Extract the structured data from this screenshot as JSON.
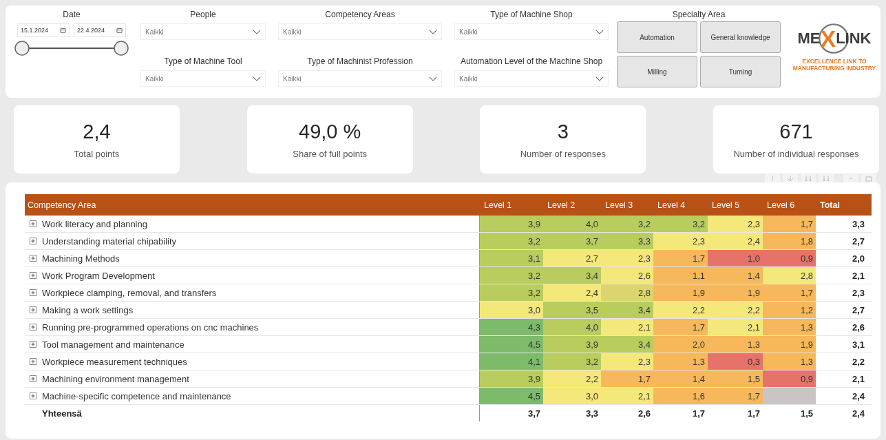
{
  "filters": {
    "date": {
      "label": "Date",
      "start": "15.1.2024",
      "end": "22.4.2024",
      "thumbs": [
        {
          "level": 0
        },
        {
          "level": 1
        }
      ]
    },
    "dropdowns": [
      {
        "label": "People",
        "value": "Kaikki"
      },
      {
        "label": "Competency Areas",
        "value": "Kaikki"
      },
      {
        "label": "Type of Machine Shop",
        "value": "Kaikki"
      },
      {
        "label": "Type of Machine Tool",
        "value": "Kaikki"
      },
      {
        "label": "Type of Machinist Profession",
        "value": "Kaikki"
      },
      {
        "label": "Automation Level of the Machine Shop",
        "value": "Kaikki"
      }
    ],
    "specialty": {
      "label": "Specialty Area",
      "buttons": [
        "Automation",
        "General knowledge",
        "Milling",
        "Turning"
      ]
    }
  },
  "logo": {
    "left": "ME",
    "mark": "X",
    "right": "LINK",
    "tagline": "EXCELLENCE LINK TO MANUFACTURING INDUSTRY"
  },
  "kpis": [
    {
      "value": "2,4",
      "label": "Total points"
    },
    {
      "value": "49,0 %",
      "label": "Share of full points"
    },
    {
      "value": "3",
      "label": "Number of responses"
    },
    {
      "value": "671",
      "label": "Number of individual responses"
    }
  ],
  "table": {
    "columns": [
      "Competency Area",
      "Level 1",
      "Level 2",
      "Level 3",
      "Level 4",
      "Level 5",
      "Level 6",
      "Total"
    ],
    "rows": [
      {
        "name": "Work literacy and planning",
        "expanded": false,
        "cells": [
          {
            "value": "3,9",
            "color": "#b9cc5e"
          },
          {
            "value": "4,0",
            "color": "#b9cc5e"
          },
          {
            "value": "3,2",
            "color": "#b9cc5e"
          },
          {
            "value": "3,2",
            "color": "#b9cc5e"
          },
          {
            "value": "2,3",
            "color": "#f5e87a"
          },
          {
            "value": "1,7",
            "color": "#f6b85a"
          }
        ],
        "total": "3,3"
      },
      {
        "name": "Understanding material chipability",
        "expanded": false,
        "cells": [
          {
            "value": "3,2",
            "color": "#b9cc5e"
          },
          {
            "value": "3,7",
            "color": "#b9cc5e"
          },
          {
            "value": "3,3",
            "color": "#b9cc5e"
          },
          {
            "value": "2,3",
            "color": "#f5e87a"
          },
          {
            "value": "2,4",
            "color": "#f5e87a"
          },
          {
            "value": "1,8",
            "color": "#f6b85a"
          }
        ],
        "total": "2,7"
      },
      {
        "name": "Machining Methods",
        "expanded": false,
        "cells": [
          {
            "value": "3,1",
            "color": "#b9cc5e"
          },
          {
            "value": "2,7",
            "color": "#f5e87a"
          },
          {
            "value": "2,3",
            "color": "#f5e87a"
          },
          {
            "value": "1,7",
            "color": "#f6b85a"
          },
          {
            "value": "1,0",
            "color": "#e5736a"
          },
          {
            "value": "0,9",
            "color": "#e5736a"
          }
        ],
        "total": "2,0"
      },
      {
        "name": "Work Program Development",
        "expanded": false,
        "cells": [
          {
            "value": "3,2",
            "color": "#b9cc5e"
          },
          {
            "value": "3,4",
            "color": "#b9cc5e"
          },
          {
            "value": "2,6",
            "color": "#f5e87a"
          },
          {
            "value": "1,1",
            "color": "#f6b85a"
          },
          {
            "value": "1,4",
            "color": "#f6b85a"
          },
          {
            "value": "2,8",
            "color": "#f5e87a"
          }
        ],
        "total": "2,1"
      },
      {
        "name": "Workpiece clamping, removal, and transfers",
        "expanded": false,
        "cells": [
          {
            "value": "3,2",
            "color": "#b9cc5e"
          },
          {
            "value": "2,4",
            "color": "#f5e87a"
          },
          {
            "value": "2,8",
            "color": "#dcd56e"
          },
          {
            "value": "1,9",
            "color": "#f6b85a"
          },
          {
            "value": "1,9",
            "color": "#f6b85a"
          },
          {
            "value": "1,7",
            "color": "#f6b85a"
          }
        ],
        "total": "2,3"
      },
      {
        "name": "Making a work settings",
        "expanded": false,
        "cells": [
          {
            "value": "3,0",
            "color": "#f5e87a"
          },
          {
            "value": "3,5",
            "color": "#b9cc5e"
          },
          {
            "value": "3,4",
            "color": "#b9cc5e"
          },
          {
            "value": "2,2",
            "color": "#f5e87a"
          },
          {
            "value": "2,2",
            "color": "#f5e87a"
          },
          {
            "value": "1,2",
            "color": "#f6b85a"
          }
        ],
        "total": "2,7"
      },
      {
        "name": "Running pre-programmed operations on cnc machines",
        "expanded": false,
        "cells": [
          {
            "value": "4,3",
            "color": "#7dbb6a"
          },
          {
            "value": "4,0",
            "color": "#b9cc5e"
          },
          {
            "value": "2,1",
            "color": "#f5e87a"
          },
          {
            "value": "1,7",
            "color": "#f6b85a"
          },
          {
            "value": "2,1",
            "color": "#f5e87a"
          },
          {
            "value": "1,3",
            "color": "#f6b85a"
          }
        ],
        "total": "2,6"
      },
      {
        "name": "Tool management and maintenance",
        "expanded": false,
        "cells": [
          {
            "value": "4,5",
            "color": "#7dbb6a"
          },
          {
            "value": "3,9",
            "color": "#b9cc5e"
          },
          {
            "value": "3,4",
            "color": "#b9cc5e"
          },
          {
            "value": "2,0",
            "color": "#f6b85a"
          },
          {
            "value": "1,3",
            "color": "#f6b85a"
          },
          {
            "value": "1,9",
            "color": "#f6b85a"
          }
        ],
        "total": "3,1"
      },
      {
        "name": "Workpiece measurement techniques",
        "expanded": false,
        "cells": [
          {
            "value": "4,1",
            "color": "#7dbb6a"
          },
          {
            "value": "3,2",
            "color": "#b9cc5e"
          },
          {
            "value": "2,3",
            "color": "#f5e87a"
          },
          {
            "value": "1,3",
            "color": "#f6b85a"
          },
          {
            "value": "0,3",
            "color": "#e5736a"
          },
          {
            "value": "1,3",
            "color": "#f6b85a"
          }
        ],
        "total": "2,2"
      },
      {
        "name": "Machining environment management",
        "expanded": false,
        "cells": [
          {
            "value": "3,9",
            "color": "#b9cc5e"
          },
          {
            "value": "2,2",
            "color": "#f5e87a"
          },
          {
            "value": "1,7",
            "color": "#f6b85a"
          },
          {
            "value": "1,4",
            "color": "#f6b85a"
          },
          {
            "value": "1,5",
            "color": "#f6b85a"
          },
          {
            "value": "0,9",
            "color": "#e5736a"
          }
        ],
        "total": "2,1"
      },
      {
        "name": "Machine-specific competence and maintenance",
        "expanded": false,
        "cells": [
          {
            "value": "4,5",
            "color": "#7dbb6a"
          },
          {
            "value": "3,0",
            "color": "#f5e87a"
          },
          {
            "value": "2,1",
            "color": "#f5e87a"
          },
          {
            "value": "1,6",
            "color": "#f6b85a"
          },
          {
            "value": "1,7",
            "color": "#f6b85a"
          },
          {
            "color": "#c9c5c5"
          }
        ],
        "total": "2,4"
      }
    ],
    "footer": {
      "name": "Yhteensä",
      "values": [
        "3,7",
        "3,3",
        "2,6",
        "1,7",
        "1,7",
        "1,5"
      ],
      "total": "2,4"
    }
  }
}
